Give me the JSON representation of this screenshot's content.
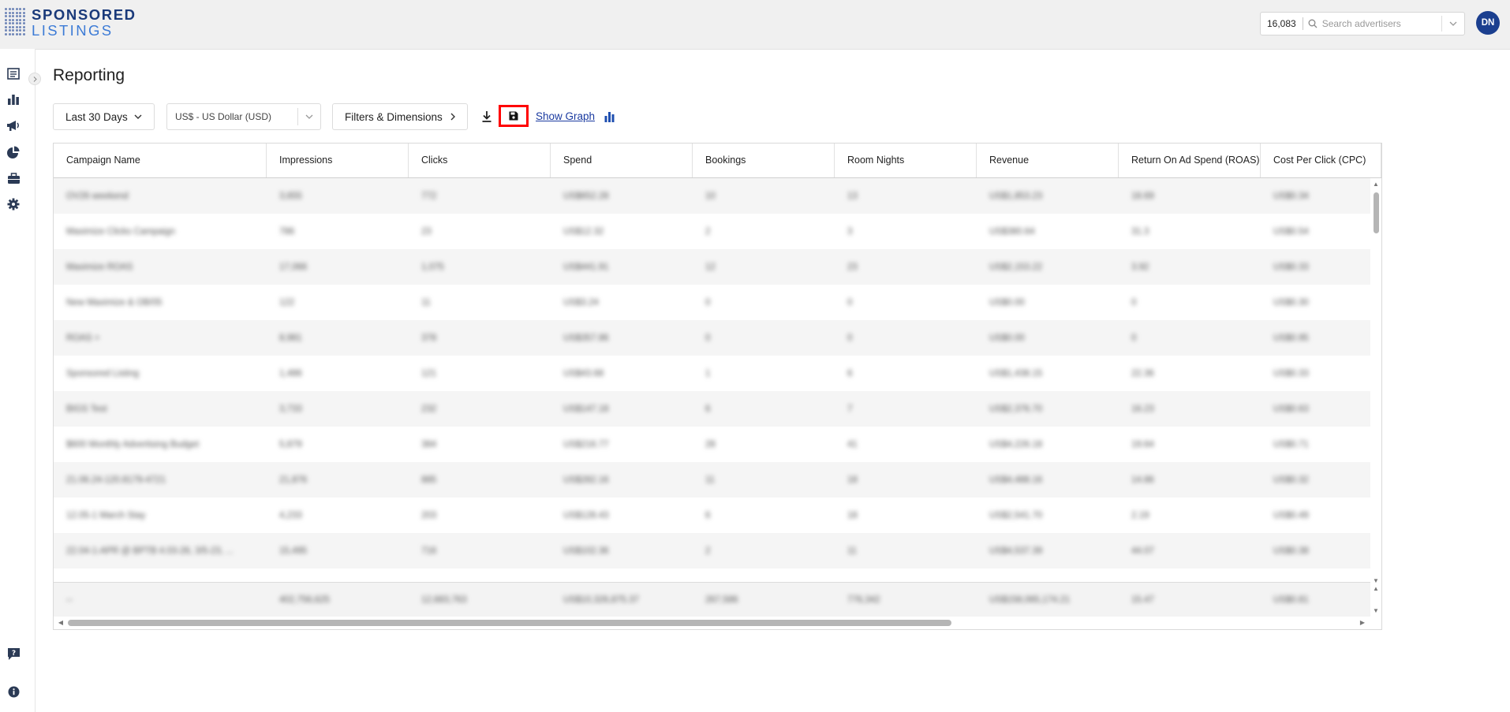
{
  "brand": {
    "line1": "SPONSORED",
    "line2": "LISTINGS"
  },
  "header": {
    "advertiser_count": "16,083",
    "search_placeholder": "Search advertisers",
    "user_initials": "DN"
  },
  "sidebar": {
    "items": [
      {
        "icon": "list-icon",
        "name": "campaigns"
      },
      {
        "icon": "bar-chart-icon",
        "name": "reporting"
      },
      {
        "icon": "megaphone-icon",
        "name": "promotions"
      },
      {
        "icon": "pie-chart-icon",
        "name": "analytics"
      },
      {
        "icon": "briefcase-icon",
        "name": "accounts"
      },
      {
        "icon": "gear-icon",
        "name": "settings"
      }
    ],
    "bottom": [
      {
        "icon": "help-chat-icon",
        "name": "help"
      },
      {
        "icon": "info-icon",
        "name": "info"
      }
    ]
  },
  "page": {
    "title": "Reporting"
  },
  "toolbar": {
    "date_range": "Last 30 Days",
    "currency": "US$ - US Dollar (USD)",
    "filters_label": "Filters & Dimensions",
    "show_graph": "Show Graph"
  },
  "table": {
    "columns": [
      {
        "label": "Campaign Name"
      },
      {
        "label": "Impressions"
      },
      {
        "label": "Clicks"
      },
      {
        "label": "Spend"
      },
      {
        "label": "Bookings"
      },
      {
        "label": "Room Nights"
      },
      {
        "label": "Revenue"
      },
      {
        "label": "Return On Ad Spend (ROAS)"
      },
      {
        "label": "Cost Per Click (CPC)"
      }
    ],
    "rows": [
      [
        "OV26 weekend",
        "3,655",
        "772",
        "US$652.28",
        "10",
        "13",
        "US$1,853.23",
        "18.69",
        "US$0.34"
      ],
      [
        "Maximize Clicks Campaign",
        "786",
        "23",
        "US$12.32",
        "2",
        "3",
        "US$380.64",
        "31.3",
        "US$0.54"
      ],
      [
        "Maximize ROAS",
        "17,066",
        "1,075",
        "US$441.91",
        "12",
        "23",
        "US$2,153.22",
        "3.92",
        "US$0.33"
      ],
      [
        "New Maximize & OB/05",
        "122",
        "11",
        "US$3.24",
        "0",
        "0",
        "US$0.00",
        "0",
        "US$0.30"
      ],
      [
        "ROAS +",
        "8,981",
        "378",
        "US$357.86",
        "0",
        "0",
        "US$0.00",
        "0",
        "US$0.95"
      ],
      [
        "Sponsored Listing",
        "1,486",
        "121",
        "US$43.68",
        "1",
        "6",
        "US$1,438.15",
        "22.36",
        "US$0.33"
      ],
      [
        "BIGS Test",
        "3,733",
        "232",
        "US$147.18",
        "6",
        "7",
        "US$2,376.70",
        "16.23",
        "US$0.63"
      ],
      [
        "$600 Monthly Advertising Budget",
        "5,879",
        "384",
        "US$216.77",
        "28",
        "41",
        "US$4,226.18",
        "19.64",
        "US$0.71"
      ],
      [
        "21.06.24-120.8179-4721",
        "21,876",
        "885",
        "US$282.16",
        "11",
        "18",
        "US$4,488.16",
        "14.86",
        "US$0.32"
      ],
      [
        "12.05-1 March Stay",
        "4,233",
        "203",
        "US$128.43",
        "6",
        "18",
        "US$2,541.70",
        "2.19",
        "US$0.49"
      ],
      [
        "22.04-1-APR @ BPTB 4.03-26, 3/5-23, ...",
        "15,495",
        "716",
        "US$102.36",
        "2",
        "11",
        "US$4,537.39",
        "44.07",
        "US$0.38"
      ]
    ],
    "totals": [
      "--",
      "402,756,625",
      "12,683,763",
      "US$10,326,875.37",
      "267,586",
      "776,342",
      "US$158,065,174.21",
      "15.47",
      "US$0.81"
    ]
  }
}
